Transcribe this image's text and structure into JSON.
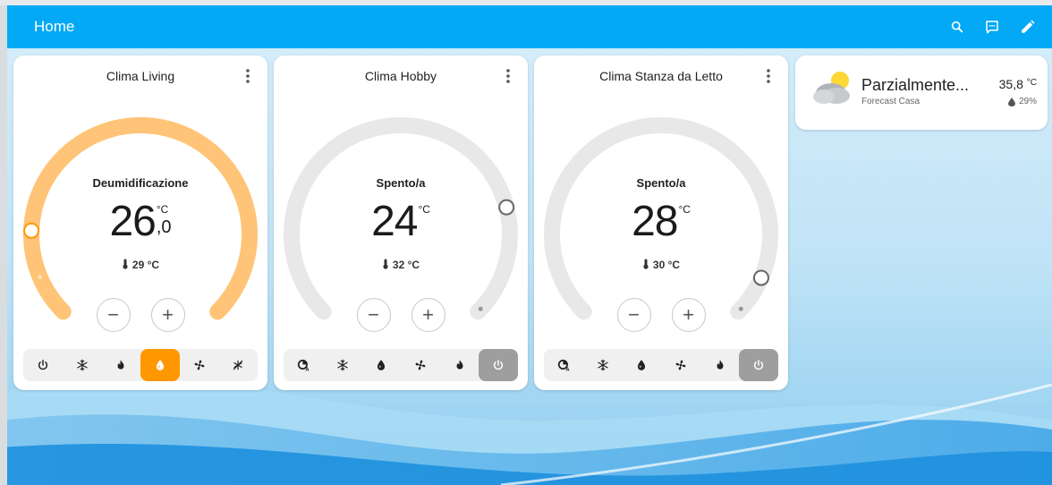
{
  "header": {
    "title": "Home",
    "icons": [
      "search-icon",
      "assist-icon",
      "edit-icon"
    ]
  },
  "climates": [
    {
      "name": "Clima Living",
      "state": "Deumidificazione",
      "target_int": "26",
      "target_dec": ",0",
      "unit": "°C",
      "current": "29 °C",
      "color": "#ffc477",
      "level": 0.0,
      "modes": [
        "power-icon",
        "snowflake-icon",
        "flame-icon",
        "water-drop-icon",
        "fan-icon",
        "sun-snowflake-icon"
      ],
      "active_mode": 3
    },
    {
      "name": "Clima Hobby",
      "state": "Spento/a",
      "target_int": "24",
      "target_dec": "",
      "unit": "°C",
      "current": "32 °C",
      "color": "#e8e8e8",
      "level": 0.78,
      "modes": [
        "auto-icon",
        "snowflake-icon",
        "water-drop-icon",
        "fan-icon",
        "flame-icon",
        "power-icon"
      ],
      "active_mode": 5
    },
    {
      "name": "Clima Stanza da Letto",
      "state": "Spento/a",
      "target_int": "28",
      "target_dec": "",
      "unit": "°C",
      "current": "30 °C",
      "color": "#e8e8e8",
      "level": 0.92,
      "modes": [
        "auto-icon",
        "snowflake-icon",
        "water-drop-icon",
        "fan-icon",
        "flame-icon",
        "power-icon"
      ],
      "active_mode": 5
    }
  ],
  "stepper": {
    "minus": "−",
    "plus": "+"
  },
  "weather": {
    "condition": "Parzialmente...",
    "location": "Forecast Casa",
    "temp": "35,8",
    "unit": "°C",
    "humidity": "29%",
    "icon": "partly-cloudy-icon"
  },
  "colors": {
    "header": "#03a9f4",
    "active_mode": "#ff9800",
    "off_mode": "#9e9e9e",
    "gauge_track": "#e8e8e8",
    "gauge_active": "#ffc477"
  }
}
